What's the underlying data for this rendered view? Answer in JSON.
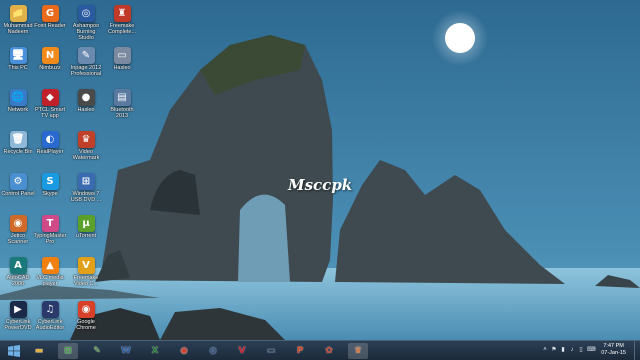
{
  "desktop": {
    "watermark": "Msccpk",
    "icons": [
      {
        "label": "Muhammad Nadeem",
        "icon": "user-folder-icon",
        "color": "#e0b04a",
        "glyph": "📁"
      },
      {
        "label": "This PC",
        "icon": "computer-icon",
        "color": "#4a90d9",
        "glyph": "🖥"
      },
      {
        "label": "Network",
        "icon": "network-icon",
        "color": "#3a7bc8",
        "glyph": "🌐"
      },
      {
        "label": "Recycle Bin",
        "icon": "recycle-bin-icon",
        "color": "#8fb8d8",
        "glyph": "🗑"
      },
      {
        "label": "Control Panel",
        "icon": "control-panel-icon",
        "color": "#4a8fd0",
        "glyph": "⚙"
      },
      {
        "label": "Jetico Scanner",
        "icon": "scanner-icon",
        "color": "#d06a2a",
        "glyph": "◉"
      },
      {
        "label": "AutoCAD 2006",
        "icon": "autocad-icon",
        "color": "#1a7a7a",
        "glyph": "A"
      },
      {
        "label": "CyberLink PowerDVD",
        "icon": "powerdvd-icon",
        "color": "#1c2a4a",
        "glyph": "▶"
      },
      {
        "label": "Foxit Reader",
        "icon": "foxit-reader-icon",
        "color": "#e86a1a",
        "glyph": "G"
      },
      {
        "label": "Nimbuzz",
        "icon": "nimbuzz-icon",
        "color": "#f08a1a",
        "glyph": "N"
      },
      {
        "label": "PTCL Smart TV app",
        "icon": "tv-app-icon",
        "color": "#c0202a",
        "glyph": "◆"
      },
      {
        "label": "RealPlayer",
        "icon": "realplayer-icon",
        "color": "#2a6ad0",
        "glyph": "◐"
      },
      {
        "label": "Skype",
        "icon": "skype-icon",
        "color": "#1a9ae0",
        "glyph": "S"
      },
      {
        "label": "TypingMaster Pro",
        "icon": "typingmaster-icon",
        "color": "#d04a8a",
        "glyph": "T"
      },
      {
        "label": "VLC media player",
        "icon": "vlc-icon",
        "color": "#f08010",
        "glyph": "▲"
      },
      {
        "label": "CyberLink AudioEditor",
        "icon": "audio-editor-icon",
        "color": "#2a3a6a",
        "glyph": "♫"
      },
      {
        "label": "Ashampoo Burning Studio",
        "icon": "burning-studio-icon",
        "color": "#2a5aa0",
        "glyph": "◎"
      },
      {
        "label": "Inpage 2012 Professional",
        "icon": "inpage-icon",
        "color": "#6a8ab0",
        "glyph": "✎"
      },
      {
        "label": "Hasleo",
        "icon": "hasleo-icon",
        "color": "#4a4a4a",
        "glyph": "●"
      },
      {
        "label": "Video Watermark",
        "icon": "video-watermark-icon",
        "color": "#c0402a",
        "glyph": "♛"
      },
      {
        "label": "Windows 7 USB DVD ...",
        "icon": "windows-usb-icon",
        "color": "#3a6ab0",
        "glyph": "⊞"
      },
      {
        "label": "uTorrent",
        "icon": "utorrent-icon",
        "color": "#5aa02a",
        "glyph": "µ"
      },
      {
        "label": "Freemake Video C...",
        "icon": "freemake-icon",
        "color": "#e0a01a",
        "glyph": "V"
      },
      {
        "label": "Google Chrome",
        "icon": "chrome-icon",
        "color": "#d8402a",
        "glyph": "◉"
      },
      {
        "label": "Freemake Complete...",
        "icon": "freemake-complete-icon",
        "color": "#c03a2a",
        "glyph": "♜"
      },
      {
        "label": "Hasleo",
        "icon": "hasleo2-icon",
        "color": "#7a8aa0",
        "glyph": "▭"
      },
      {
        "label": "Bluetooth 2013",
        "icon": "bluetooth-icon",
        "color": "#5a7aa0",
        "glyph": "▤"
      }
    ]
  },
  "taskbar": {
    "buttons": [
      {
        "name": "file-explorer-icon",
        "color": "#e0b04a",
        "glyph": "▬",
        "active": false
      },
      {
        "name": "windows-store-icon",
        "color": "#3aa03a",
        "glyph": "⊞",
        "active": true
      },
      {
        "name": "notepad-icon",
        "color": "#5a9a3a",
        "glyph": "✎",
        "active": false
      },
      {
        "name": "word-icon",
        "color": "#2a5aa0",
        "glyph": "W",
        "active": false
      },
      {
        "name": "excel-icon",
        "color": "#2a7a3a",
        "glyph": "X",
        "active": false
      },
      {
        "name": "chrome-icon",
        "color": "#d8402a",
        "glyph": "◉",
        "active": false
      },
      {
        "name": "burning-studio-icon",
        "color": "#2a5aa0",
        "glyph": "◎",
        "active": false
      },
      {
        "name": "video-converter-icon",
        "color": "#c0202a",
        "glyph": "V",
        "active": false
      },
      {
        "name": "screen-recorder-icon",
        "color": "#3a5a8a",
        "glyph": "▭",
        "active": false
      },
      {
        "name": "powerpoint-icon",
        "color": "#d04a2a",
        "glyph": "P",
        "active": false
      },
      {
        "name": "paint-icon",
        "color": "#c0402a",
        "glyph": "✿",
        "active": false
      },
      {
        "name": "video-watermark-icon",
        "color": "#d06a2a",
        "glyph": "♛",
        "active": true
      }
    ],
    "clock": {
      "time": "7:47 PM",
      "date": "07-Jan-15"
    },
    "tray": [
      "chevron-up-icon",
      "flag-icon",
      "network-tray-icon",
      "speaker-icon",
      "battery-icon",
      "keyboard-icon"
    ]
  }
}
